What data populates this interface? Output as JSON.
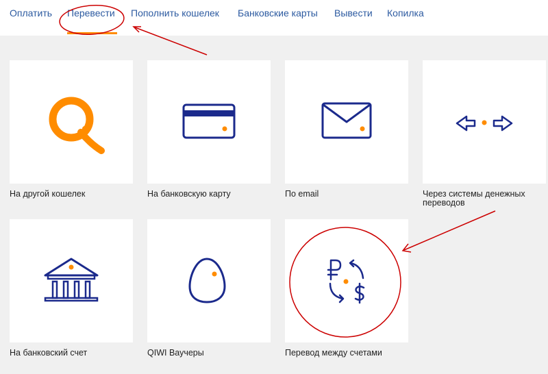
{
  "nav": {
    "items": [
      {
        "label": "Оплатить"
      },
      {
        "label": "Перевести"
      },
      {
        "label": "Пополнить кошелек"
      },
      {
        "label": "Банковские карты"
      },
      {
        "label": "Вывести"
      },
      {
        "label": "Копилка"
      }
    ],
    "active_index": 1
  },
  "tiles": [
    {
      "label": "На другой кошелек",
      "icon": "qiwi-logo-icon"
    },
    {
      "label": "На банковскую карту",
      "icon": "bank-card-icon"
    },
    {
      "label": "По email",
      "icon": "envelope-icon"
    },
    {
      "label": "Через системы денежных переводов",
      "icon": "transfer-arrows-icon"
    },
    {
      "label": "На банковский счет",
      "icon": "bank-building-icon"
    },
    {
      "label": "QIWI Ваучеры",
      "icon": "egg-voucher-icon"
    },
    {
      "label": "Перевод между счетами",
      "icon": "currency-exchange-icon"
    }
  ],
  "colors": {
    "nav_text": "#2c5aa0",
    "accent": "#ff8c00",
    "icon_stroke": "#1b2a8c",
    "annotation": "#cc0000",
    "background": "#f0f0f0"
  }
}
